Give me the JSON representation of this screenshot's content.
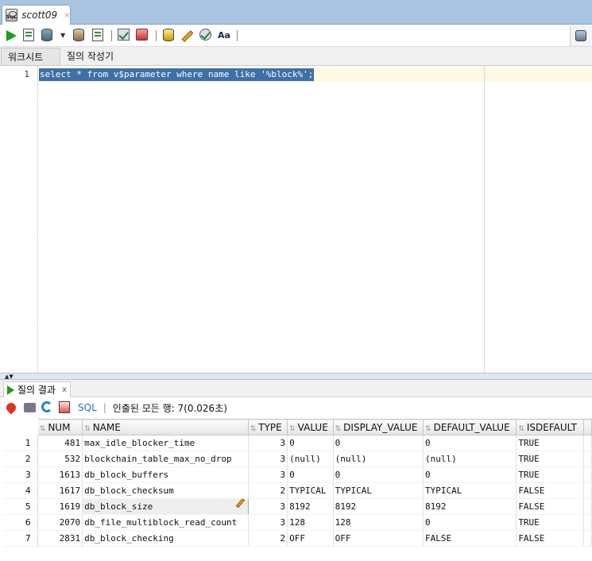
{
  "editor_tab": {
    "title": "scott09",
    "close": "×",
    "icon": "sql-file-icon"
  },
  "worksheet_tabs": [
    "워크시트",
    "질의 작성기"
  ],
  "editor": {
    "line_number": "1",
    "sql": "select * from v$parameter where name like '%block%';"
  },
  "results": {
    "tab_label": "질의 결과",
    "tab_close": "x",
    "sql_link": "SQL",
    "separator": "|",
    "fetch_status": "인출된 모든 행: 7(0.026초)",
    "columns": [
      "NUM",
      "NAME",
      "TYPE",
      "VALUE",
      "DISPLAY_VALUE",
      "DEFAULT_VALUE",
      "ISDEFAULT"
    ],
    "rows": [
      {
        "rownum": "1",
        "num": "481",
        "name": "max_idle_blocker_time",
        "type": "3",
        "value": "0",
        "display_value": "0",
        "default_value": "0",
        "isdefault": "TRUE"
      },
      {
        "rownum": "2",
        "num": "532",
        "name": "blockchain_table_max_no_drop",
        "type": "3",
        "value": "(null)",
        "display_value": "(null)",
        "default_value": "(null)",
        "isdefault": "TRUE"
      },
      {
        "rownum": "3",
        "num": "1613",
        "name": "db_block_buffers",
        "type": "3",
        "value": "0",
        "display_value": "0",
        "default_value": "0",
        "isdefault": "TRUE"
      },
      {
        "rownum": "4",
        "num": "1617",
        "name": "db_block_checksum",
        "type": "2",
        "value": "TYPICAL",
        "display_value": "TYPICAL",
        "default_value": "TYPICAL",
        "isdefault": "FALSE"
      },
      {
        "rownum": "5",
        "num": "1619",
        "name": "db_block_size",
        "type": "3",
        "value": "8192",
        "display_value": "8192",
        "default_value": "8192",
        "isdefault": "FALSE"
      },
      {
        "rownum": "6",
        "num": "2070",
        "name": "db_file_multiblock_read_count",
        "type": "3",
        "value": "128",
        "display_value": "128",
        "default_value": "0",
        "isdefault": "TRUE"
      },
      {
        "rownum": "7",
        "num": "2831",
        "name": "db_block_checking",
        "type": "2",
        "value": "OFF",
        "display_value": "OFF",
        "default_value": "FALSE",
        "isdefault": "FALSE"
      }
    ]
  },
  "colors": {
    "selection": "#3e70a8",
    "run_green": "#1f9a1f",
    "link_blue": "#2a6fcf",
    "tabstrip": "#a8c4e0"
  }
}
